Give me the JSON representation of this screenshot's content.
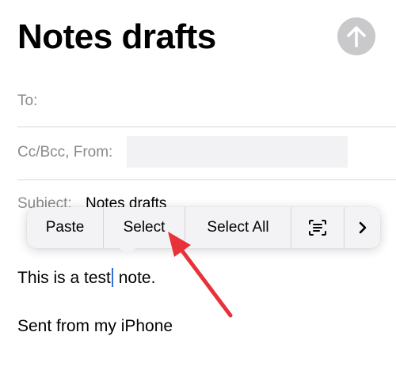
{
  "header": {
    "title": "Notes drafts",
    "send_icon": "arrow-up-icon"
  },
  "fields": {
    "to_label": "To:",
    "ccbcc_from_label": "Cc/Bcc, From:",
    "subject_label": "Subject:",
    "subject_value": "Notes drafts"
  },
  "body": {
    "line1_before_cursor": "This is a test",
    "line1_after_cursor": " note.",
    "signature": "Sent from my iPhone"
  },
  "context_menu": {
    "paste": "Paste",
    "select": "Select",
    "select_all": "Select All",
    "scan_icon": "scan-text-icon",
    "more_icon": "chevron-right-icon"
  },
  "colors": {
    "annotation_arrow": "#e8323a",
    "send_button": "#c9c9cc",
    "cursor": "#2f6fe0"
  }
}
